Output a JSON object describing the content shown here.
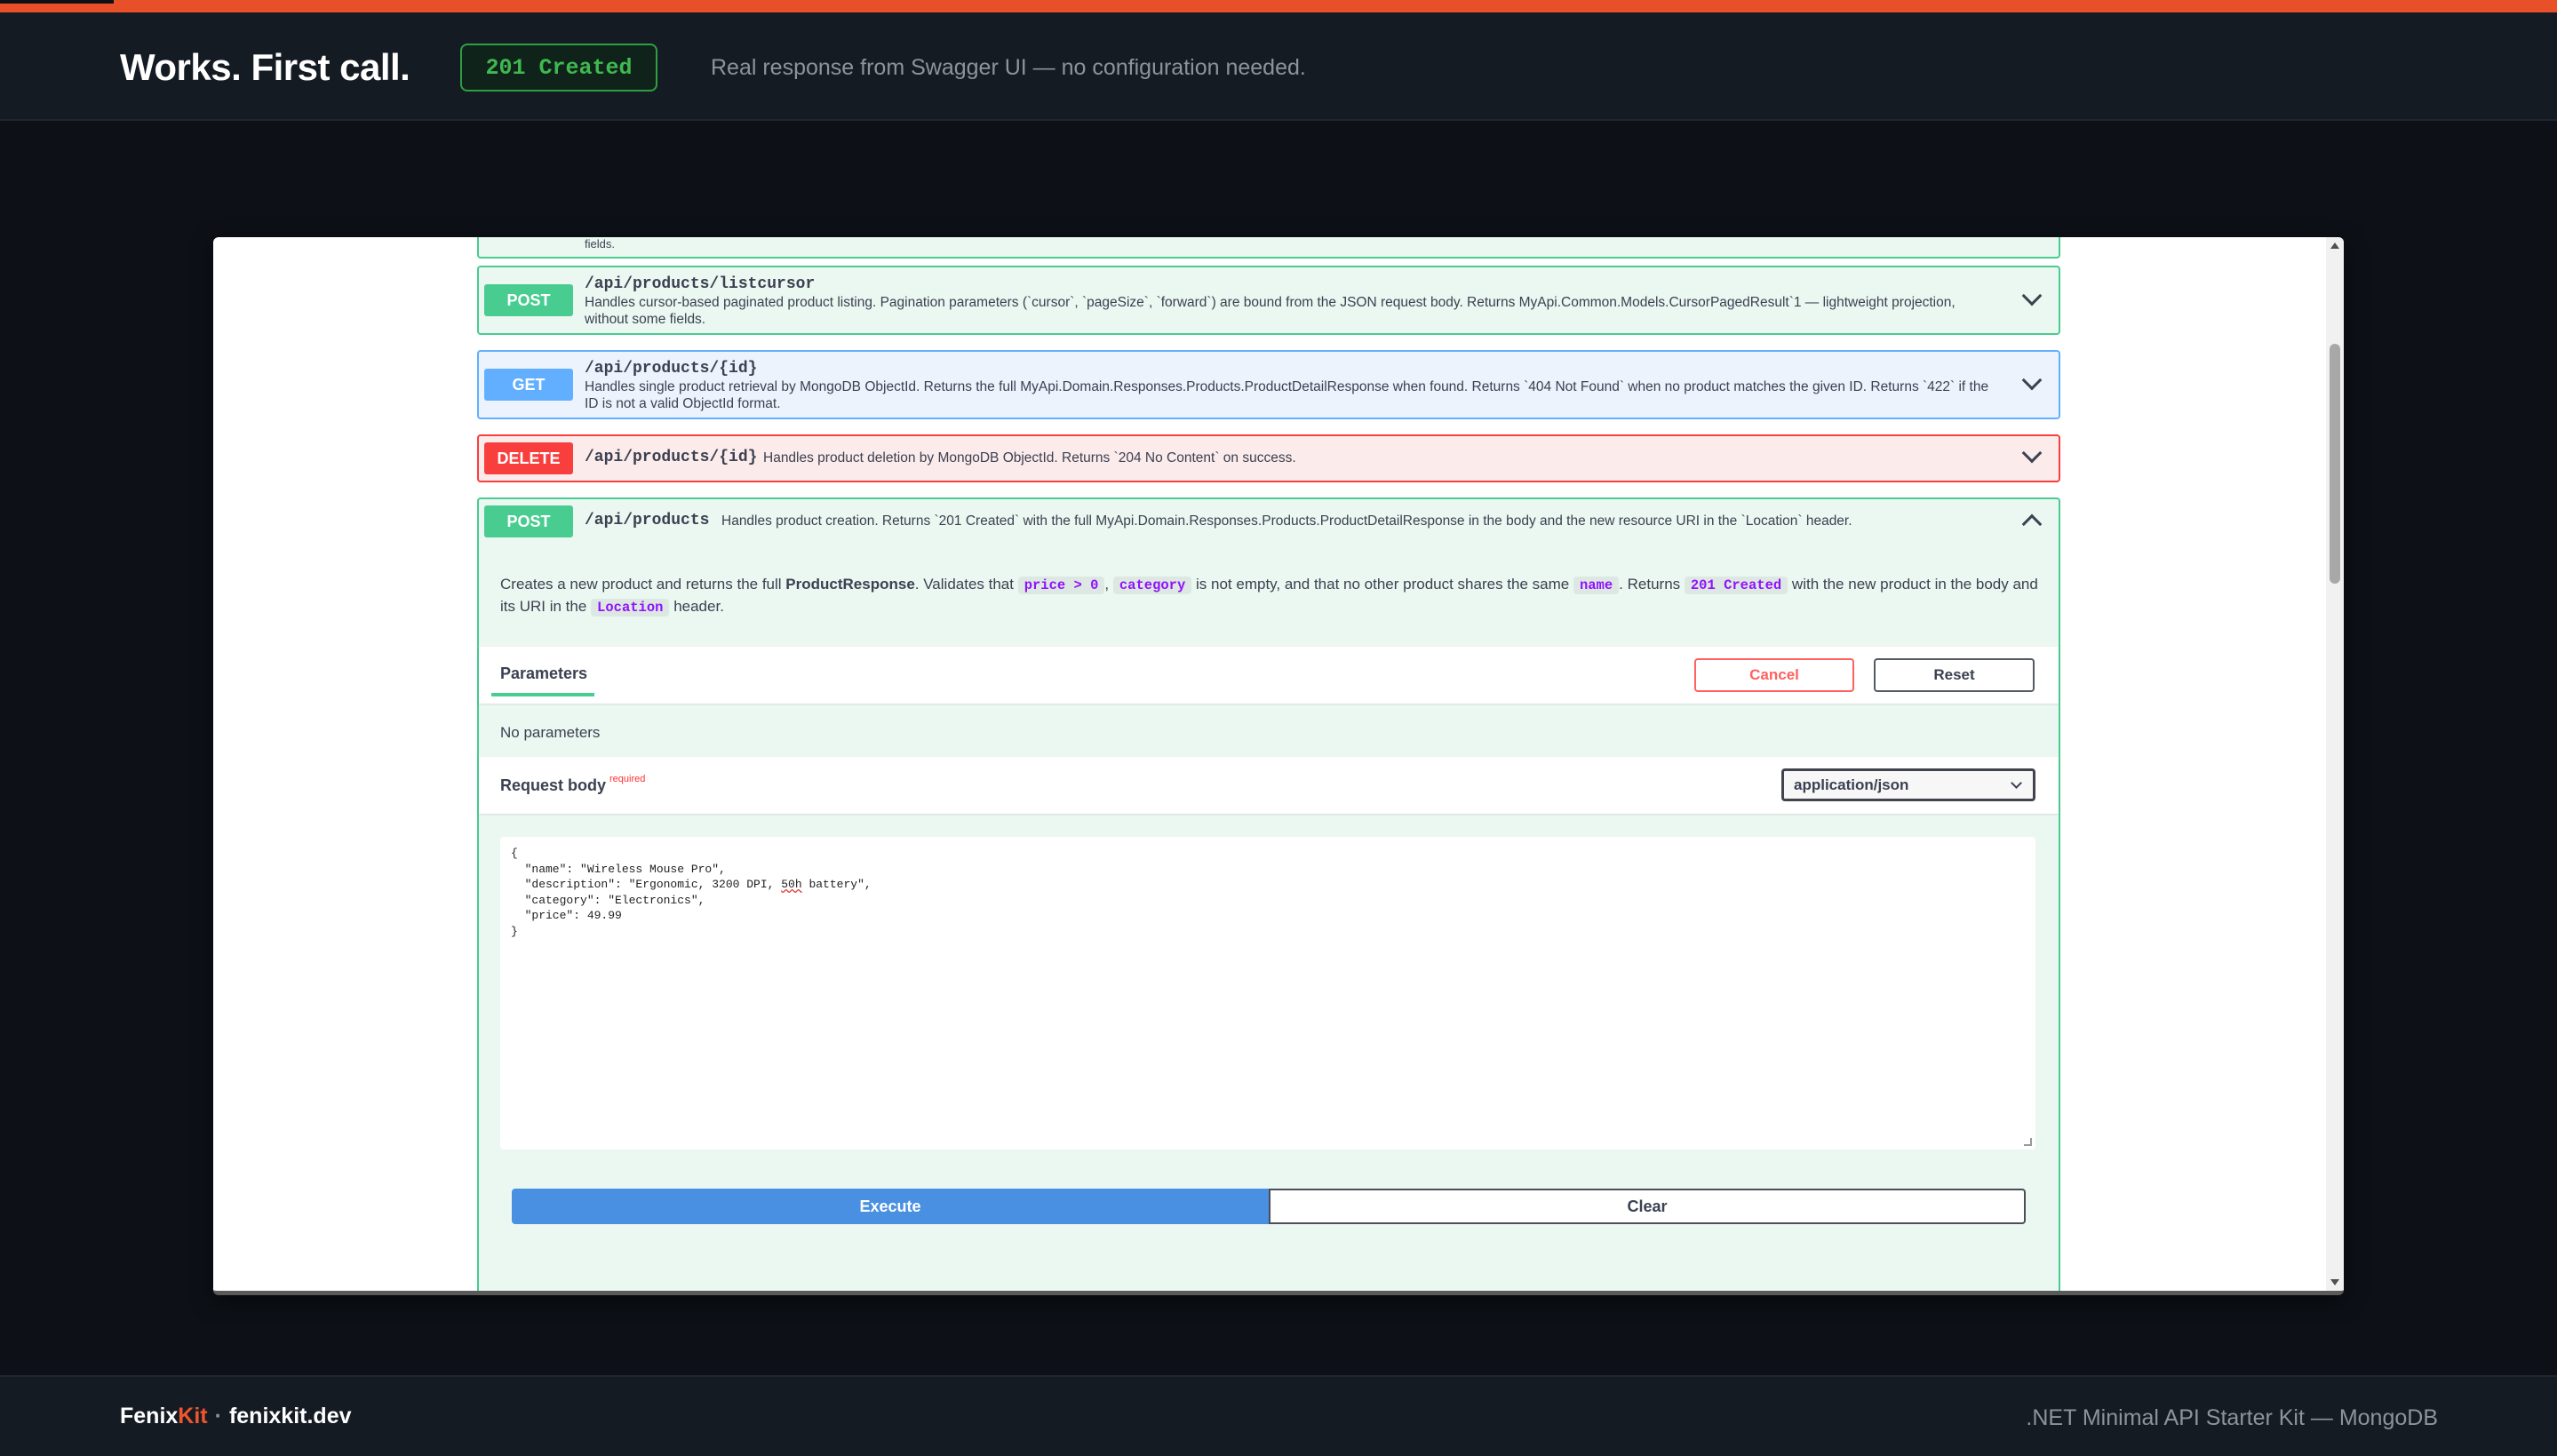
{
  "header": {
    "title": "Works. First call.",
    "status": "201 Created",
    "subtitle": "Real response from Swagger UI — no configuration needed."
  },
  "swagger": {
    "truncated_text": "fields.",
    "ops": [
      {
        "method": "POST",
        "path": "/api/products/listcursor",
        "summary": "Handles cursor-based paginated product listing. Pagination parameters (`cursor`, `pageSize`, `forward`) are bound from the JSON request body. Returns MyApi.Common.Models.CursorPagedResult`1 — lightweight projection, without some fields."
      },
      {
        "method": "GET",
        "path": "/api/products/{id}",
        "summary": "Handles single product retrieval by MongoDB ObjectId. Returns the full MyApi.Domain.Responses.Products.ProductDetailResponse when found. Returns `404 Not Found` when no product matches the given ID. Returns `422` if the ID is not a valid ObjectId format."
      },
      {
        "method": "DELETE",
        "path": "/api/products/{id}",
        "summary": "Handles product deletion by MongoDB ObjectId. Returns `204 No Content` on success."
      },
      {
        "method": "POST",
        "path": "/api/products",
        "summary": "Handles product creation. Returns `201 Created` with the full MyApi.Domain.Responses.Products.ProductDetailResponse in the body and the new resource URI in the `Location` header."
      }
    ],
    "description": {
      "t1": "Creates a new product and returns the full ",
      "bold": "ProductResponse",
      "t2": ". Validates that ",
      "c1": "price > 0",
      "t3": ", ",
      "c2": "category",
      "t4": " is not empty, and that no other product shares the same ",
      "c3": "name",
      "t5": ". Returns ",
      "c4": "201 Created",
      "t6": " with the new product in the body and its URI in the ",
      "c5": "Location",
      "t7": " header."
    },
    "parameters_tab": "Parameters",
    "cancel": "Cancel",
    "reset": "Reset",
    "no_parameters": "No parameters",
    "request_body_label": "Request body",
    "required": "required",
    "content_type": "application/json",
    "body_lines": {
      "l1": "{",
      "l2": "  \"name\": \"Wireless Mouse Pro\",",
      "l3a": "  \"description\": \"Ergonomic, 3200 DPI, ",
      "l3b": "50h",
      "l3c": " battery\",",
      "l4": "  \"category\": \"Electronics\",",
      "l5": "  \"price\": 49.99",
      "l6": "}"
    },
    "execute": "Execute",
    "clear": "Clear"
  },
  "footer": {
    "brand_a": "Fenix",
    "brand_b": "Kit",
    "separator": "·",
    "site": "fenixkit.dev",
    "right": ".NET Minimal API Starter Kit — MongoDB"
  },
  "colors": {
    "accent": "#e8502a",
    "post": "#49cc90",
    "get": "#61affe",
    "delete": "#f93e3e",
    "execute": "#4990e2"
  }
}
